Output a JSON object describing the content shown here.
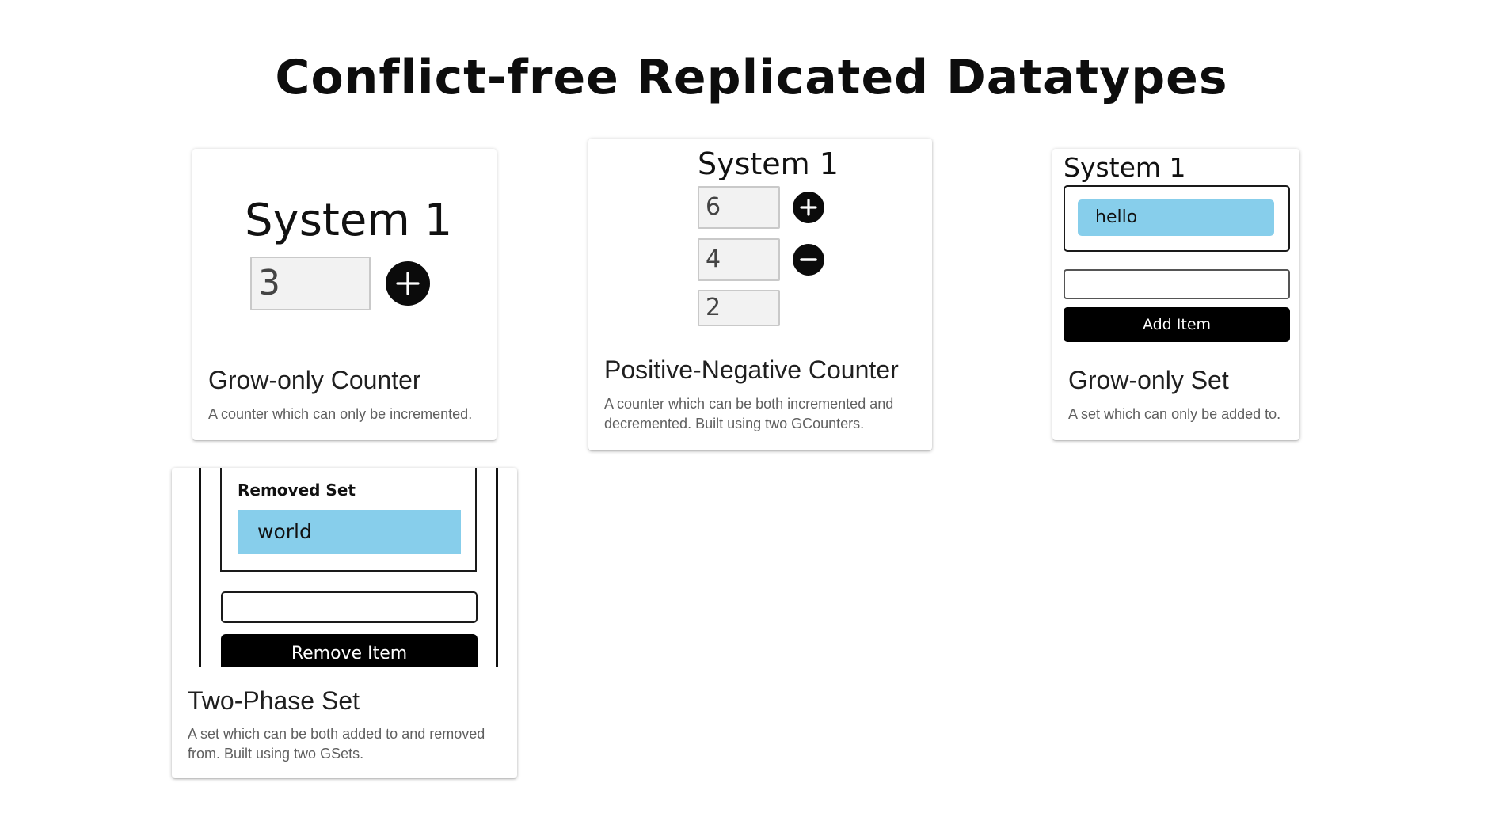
{
  "page": {
    "title": "Conflict-free Replicated Datatypes"
  },
  "cards": {
    "gcounter": {
      "system_label": "System 1",
      "value": "3",
      "increment_icon": "plus-icon",
      "title": "Grow-only Counter",
      "description": "A counter which can only be incremented."
    },
    "pncounter": {
      "system_label": "System 1",
      "positive_value": "6",
      "negative_value": "4",
      "total_value": "2",
      "increment_icon": "plus-icon",
      "decrement_icon": "minus-icon",
      "title": "Positive-Negative Counter",
      "description": "A counter which can be both incremented and decremented. Built using two GCounters."
    },
    "gset": {
      "system_label": "System 1",
      "items": [
        "hello"
      ],
      "input_value": "",
      "button_label": "Add Item",
      "title": "Grow-only Set",
      "description": "A set which can only be added to."
    },
    "twophaseset": {
      "removed_label": "Removed Set",
      "removed_items": [
        "world"
      ],
      "input_value": "",
      "button_label": "Remove Item",
      "title": "Two-Phase Set",
      "description": "A set which can be both added to and removed from. Built using two GSets."
    }
  },
  "colors": {
    "chip": "#87ceeb",
    "button": "#000000",
    "accent_text": "#1f1f1f"
  }
}
